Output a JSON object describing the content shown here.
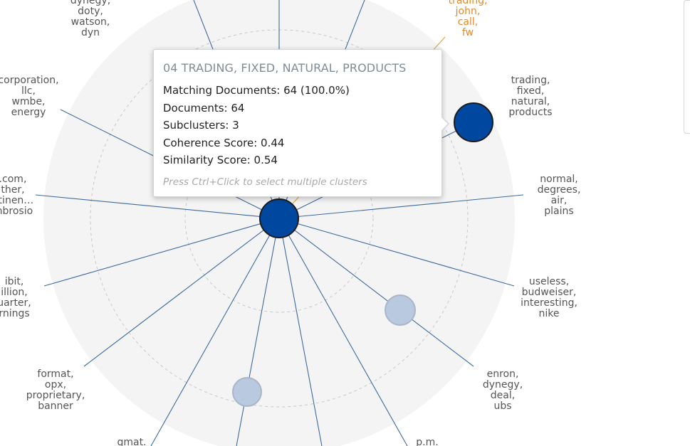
{
  "labels": [
    {
      "id": "tl",
      "lines": [
        "dynegy,",
        "doty,",
        "watson,",
        "dyn"
      ],
      "highlight": false
    },
    {
      "id": "tr",
      "lines": [
        "trading,",
        "john,",
        "call,",
        "fw"
      ],
      "highlight": true
    },
    {
      "id": "corp",
      "lines": [
        "corporation,",
        "llc,",
        "wmbe,",
        "energy"
      ],
      "highlight": false
    },
    {
      "id": "trading",
      "lines": [
        "trading,",
        "fixed,",
        "natural,",
        "products"
      ],
      "highlight": false
    },
    {
      "id": "com",
      "lines": [
        ".com,",
        "ther,",
        "ntinen…",
        "mbrosio"
      ],
      "highlight": false
    },
    {
      "id": "normal",
      "lines": [
        "normal,",
        "degrees,",
        "air,",
        "plains"
      ],
      "highlight": false
    },
    {
      "id": "ibit",
      "lines": [
        "ibit,",
        "illion,",
        "uarter,",
        "rnings"
      ],
      "highlight": false
    },
    {
      "id": "useless",
      "lines": [
        "useless,",
        "budweiser,",
        "interesting,",
        "nike"
      ],
      "highlight": false
    },
    {
      "id": "format",
      "lines": [
        "format,",
        "opx,",
        "proprietary,",
        "banner"
      ],
      "highlight": false
    },
    {
      "id": "enron",
      "lines": [
        "enron,",
        "dynegy,",
        "deal,",
        "ubs"
      ],
      "highlight": false
    },
    {
      "id": "gmat",
      "lines": [
        "gmat."
      ],
      "highlight": false
    },
    {
      "id": "pm",
      "lines": [
        "p.m."
      ],
      "highlight": false
    }
  ],
  "tooltip": {
    "title": "04 TRADING, FIXED, NATURAL, PRODUCTS",
    "matching": "Matching Documents: 64 (100.0%)",
    "documents": "Documents: 64",
    "subclusters": "Subclusters: 3",
    "coherence": "Coherence Score: 0.44",
    "similarity": "Similarity Score: 0.54",
    "hint": "Press Ctrl+Click to select multiple clusters"
  },
  "colors": {
    "node_selected": "#0047a0",
    "node_faded": "#b8c9e0",
    "spoke": "#3d6a9e",
    "highlight": "#e08a2b",
    "disc": "#f4f4f4"
  }
}
